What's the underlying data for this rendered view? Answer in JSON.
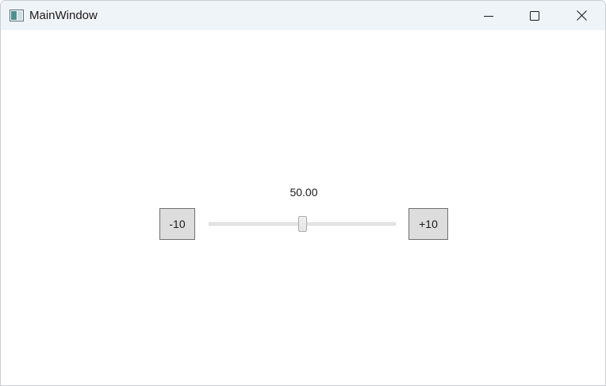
{
  "window": {
    "title": "MainWindow",
    "icon": "app-window-icon",
    "controls": {
      "minimize_icon": "minimize-icon",
      "maximize_icon": "maximize-icon",
      "close_icon": "close-icon"
    }
  },
  "content": {
    "value_label": "50.00",
    "decrement_label": "-10",
    "increment_label": "+10",
    "slider": {
      "value": 50,
      "min": 0,
      "max": 100
    }
  },
  "colors": {
    "titlebar": "#eff4f9",
    "button_face": "#dddddd",
    "button_border": "#707070"
  }
}
